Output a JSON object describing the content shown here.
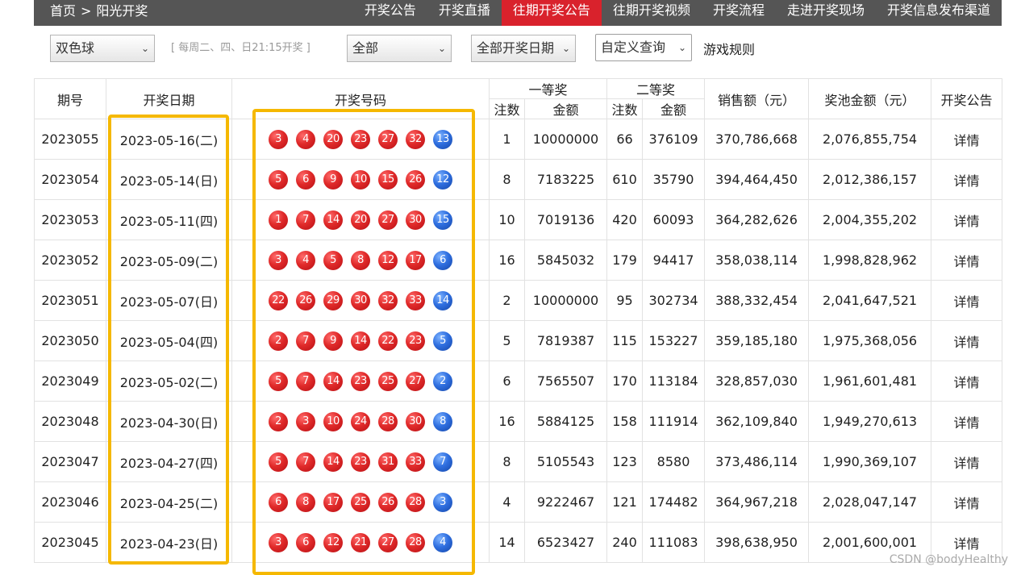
{
  "header": {
    "breadcrumb_home": "首页",
    "breadcrumb_sep": ">",
    "breadcrumb_current": "阳光开奖",
    "nav": [
      "开奖公告",
      "开奖直播",
      "往期开奖公告",
      "往期开奖视频",
      "开奖流程",
      "走进开奖现场",
      "开奖信息发布渠道"
    ],
    "active_nav_index": 2
  },
  "filters": {
    "game_select": "双色球",
    "draw_note": "[ 每周二、四、日21:15开奖 ]",
    "scope_select": "全部",
    "date_select": "全部开奖日期",
    "custom_query": "自定义查询",
    "rules_link": "游戏规则"
  },
  "colors": {
    "nav_bg": "#555555",
    "nav_active": "#d9222c",
    "highlight": "#f5b800",
    "red_ball": "#e02a2a",
    "blue_ball": "#2f6fe0"
  },
  "table": {
    "headers": {
      "issue": "期号",
      "date": "开奖日期",
      "numbers": "开奖号码",
      "first_prize": "一等奖",
      "second_prize": "二等奖",
      "count": "注数",
      "amount": "金额",
      "sales": "销售额（元）",
      "pool": "奖池金额（元）",
      "notice": "开奖公告"
    },
    "detail_label": "详情",
    "rows": [
      {
        "issue": "2023055",
        "date": "2023-05-16(二)",
        "red": [
          "3",
          "4",
          "20",
          "23",
          "27",
          "32"
        ],
        "blue": "13",
        "p1_count": "1",
        "p1_amount": "10000000",
        "p2_count": "66",
        "p2_amount": "376109",
        "sales": "370,786,668",
        "pool": "2,076,855,754"
      },
      {
        "issue": "2023054",
        "date": "2023-05-14(日)",
        "red": [
          "5",
          "6",
          "9",
          "10",
          "15",
          "26"
        ],
        "blue": "12",
        "p1_count": "8",
        "p1_amount": "7183225",
        "p2_count": "610",
        "p2_amount": "35790",
        "sales": "394,464,450",
        "pool": "2,012,386,157"
      },
      {
        "issue": "2023053",
        "date": "2023-05-11(四)",
        "red": [
          "1",
          "7",
          "14",
          "20",
          "27",
          "30"
        ],
        "blue": "15",
        "p1_count": "10",
        "p1_amount": "7019136",
        "p2_count": "420",
        "p2_amount": "60093",
        "sales": "364,282,626",
        "pool": "2,004,355,202"
      },
      {
        "issue": "2023052",
        "date": "2023-05-09(二)",
        "red": [
          "3",
          "4",
          "5",
          "8",
          "12",
          "17"
        ],
        "blue": "6",
        "p1_count": "16",
        "p1_amount": "5845032",
        "p2_count": "179",
        "p2_amount": "94417",
        "sales": "358,038,114",
        "pool": "1,998,828,962"
      },
      {
        "issue": "2023051",
        "date": "2023-05-07(日)",
        "red": [
          "22",
          "26",
          "29",
          "30",
          "32",
          "33"
        ],
        "blue": "14",
        "p1_count": "2",
        "p1_amount": "10000000",
        "p2_count": "95",
        "p2_amount": "302734",
        "sales": "388,332,454",
        "pool": "2,041,647,521"
      },
      {
        "issue": "2023050",
        "date": "2023-05-04(四)",
        "red": [
          "2",
          "7",
          "9",
          "14",
          "22",
          "23"
        ],
        "blue": "5",
        "p1_count": "5",
        "p1_amount": "7819387",
        "p2_count": "115",
        "p2_amount": "153227",
        "sales": "359,185,180",
        "pool": "1,975,368,056"
      },
      {
        "issue": "2023049",
        "date": "2023-05-02(二)",
        "red": [
          "5",
          "7",
          "14",
          "23",
          "25",
          "27"
        ],
        "blue": "2",
        "p1_count": "6",
        "p1_amount": "7565507",
        "p2_count": "170",
        "p2_amount": "113184",
        "sales": "328,857,030",
        "pool": "1,961,601,481"
      },
      {
        "issue": "2023048",
        "date": "2023-04-30(日)",
        "red": [
          "2",
          "3",
          "10",
          "24",
          "28",
          "30"
        ],
        "blue": "8",
        "p1_count": "16",
        "p1_amount": "5884125",
        "p2_count": "158",
        "p2_amount": "111914",
        "sales": "362,109,840",
        "pool": "1,949,270,613"
      },
      {
        "issue": "2023047",
        "date": "2023-04-27(四)",
        "red": [
          "5",
          "7",
          "14",
          "23",
          "31",
          "33"
        ],
        "blue": "7",
        "p1_count": "8",
        "p1_amount": "5105543",
        "p2_count": "123",
        "p2_amount": "8580",
        "sales": "373,486,114",
        "pool": "1,990,369,107"
      },
      {
        "issue": "2023046",
        "date": "2023-04-25(二)",
        "red": [
          "6",
          "8",
          "17",
          "25",
          "26",
          "28"
        ],
        "blue": "3",
        "p1_count": "4",
        "p1_amount": "9222467",
        "p2_count": "121",
        "p2_amount": "174482",
        "sales": "364,967,218",
        "pool": "2,028,047,147"
      },
      {
        "issue": "2023045",
        "date": "2023-04-23(日)",
        "red": [
          "3",
          "6",
          "12",
          "21",
          "27",
          "28"
        ],
        "blue": "4",
        "p1_count": "14",
        "p1_amount": "6523427",
        "p2_count": "240",
        "p2_amount": "111083",
        "sales": "398,638,950",
        "pool": "2,001,600,001"
      }
    ]
  },
  "watermark": "CSDN @bodyHealthy"
}
